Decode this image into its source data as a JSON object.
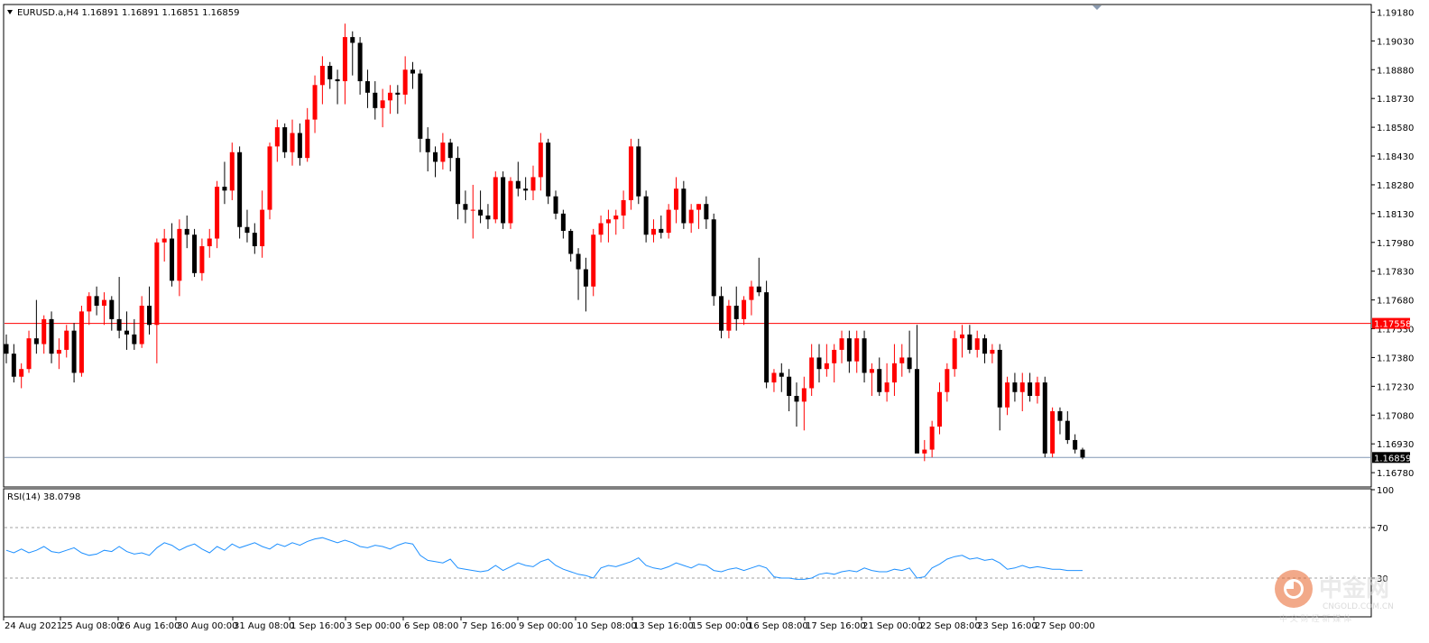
{
  "window": {
    "header": "EURUSD.a,H4  1.16891 1.16891 1.16851 1.16859",
    "rsi_header": "RSI(14) 38.0798"
  },
  "chart_data": [
    {
      "type": "candlestick",
      "title": "EURUSD.a,H4",
      "ohlc_last": {
        "open": 1.16891,
        "high": 1.16891,
        "low": 1.16851,
        "close": 1.16859
      },
      "ylim": [
        1.1671,
        1.19215
      ],
      "y_ticks": [
        "1.19180",
        "1.19030",
        "1.18880",
        "1.18730",
        "1.18580",
        "1.18430",
        "1.18280",
        "1.18130",
        "1.17980",
        "1.17830",
        "1.17680",
        "1.17530",
        "1.17380",
        "1.17230",
        "1.17080",
        "1.16930",
        "1.16780"
      ],
      "x_ticks": [
        "24 Aug 2021",
        "25 Aug 08:00",
        "26 Aug 16:00",
        "30 Aug 00:00",
        "31 Aug 08:00",
        "1 Sep 16:00",
        "3 Sep 00:00",
        "6 Sep 08:00",
        "7 Sep 16:00",
        "9 Sep 00:00",
        "10 Sep 08:00",
        "13 Sep 16:00",
        "15 Sep 00:00",
        "16 Sep 08:00",
        "17 Sep 16:00",
        "21 Sep 00:00",
        "22 Sep 08:00",
        "23 Sep 16:00",
        "27 Sep 00:00"
      ],
      "h_lines": [
        {
          "value": 1.17558,
          "label": "1.17558",
          "color": "#ff0000"
        },
        {
          "value": 1.16859,
          "label": "1.16859",
          "color": "#8096b4"
        }
      ],
      "candles": [
        [
          1.1745,
          1.175,
          1.1735,
          1.174
        ],
        [
          1.174,
          1.1745,
          1.1725,
          1.1728
        ],
        [
          1.1728,
          1.1735,
          1.1722,
          1.1732
        ],
        [
          1.1732,
          1.1752,
          1.173,
          1.1748
        ],
        [
          1.1748,
          1.1768,
          1.174,
          1.1745
        ],
        [
          1.1745,
          1.176,
          1.174,
          1.1758
        ],
        [
          1.1758,
          1.1762,
          1.1735,
          1.174
        ],
        [
          1.174,
          1.1748,
          1.1732,
          1.1742
        ],
        [
          1.1742,
          1.1755,
          1.1738,
          1.1752
        ],
        [
          1.1752,
          1.1756,
          1.1725,
          1.173
        ],
        [
          1.173,
          1.1765,
          1.1728,
          1.1762
        ],
        [
          1.1762,
          1.1772,
          1.1755,
          1.177
        ],
        [
          1.177,
          1.1775,
          1.176,
          1.1765
        ],
        [
          1.1765,
          1.1772,
          1.1755,
          1.1768
        ],
        [
          1.1768,
          1.177,
          1.1752,
          1.1758
        ],
        [
          1.1758,
          1.178,
          1.1748,
          1.1752
        ],
        [
          1.1752,
          1.1762,
          1.1742,
          1.175
        ],
        [
          1.175,
          1.1758,
          1.1742,
          1.1745
        ],
        [
          1.1745,
          1.177,
          1.1743,
          1.1765
        ],
        [
          1.1765,
          1.1775,
          1.175,
          1.1755
        ],
        [
          1.1755,
          1.18,
          1.1735,
          1.1798
        ],
        [
          1.1798,
          1.1805,
          1.1788,
          1.18
        ],
        [
          1.18,
          1.1808,
          1.1775,
          1.1778
        ],
        [
          1.1778,
          1.181,
          1.177,
          1.1805
        ],
        [
          1.1805,
          1.1812,
          1.1795,
          1.1802
        ],
        [
          1.1802,
          1.1805,
          1.178,
          1.1782
        ],
        [
          1.1782,
          1.18,
          1.1778,
          1.1796
        ],
        [
          1.1796,
          1.1805,
          1.179,
          1.18
        ],
        [
          1.18,
          1.183,
          1.1795,
          1.1827
        ],
        [
          1.1827,
          1.184,
          1.1818,
          1.1825
        ],
        [
          1.1825,
          1.185,
          1.182,
          1.1845
        ],
        [
          1.1845,
          1.1848,
          1.18,
          1.1806
        ],
        [
          1.1806,
          1.1815,
          1.1798,
          1.1803
        ],
        [
          1.1803,
          1.1808,
          1.1792,
          1.1796
        ],
        [
          1.1796,
          1.1825,
          1.179,
          1.1815
        ],
        [
          1.1815,
          1.185,
          1.181,
          1.1848
        ],
        [
          1.1848,
          1.1862,
          1.184,
          1.1858
        ],
        [
          1.1858,
          1.186,
          1.1842,
          1.1845
        ],
        [
          1.1845,
          1.1862,
          1.1838,
          1.1855
        ],
        [
          1.1855,
          1.186,
          1.1838,
          1.1842
        ],
        [
          1.1842,
          1.1868,
          1.184,
          1.1862
        ],
        [
          1.1862,
          1.1885,
          1.1855,
          1.188
        ],
        [
          1.188,
          1.1895,
          1.187,
          1.189
        ],
        [
          1.189,
          1.1892,
          1.1878,
          1.1883
        ],
        [
          1.1883,
          1.1888,
          1.187,
          1.1882
        ],
        [
          1.1882,
          1.1912,
          1.187,
          1.1905
        ],
        [
          1.1905,
          1.1908,
          1.1885,
          1.1902
        ],
        [
          1.1902,
          1.1905,
          1.1875,
          1.1882
        ],
        [
          1.1882,
          1.1888,
          1.1868,
          1.1876
        ],
        [
          1.1876,
          1.1882,
          1.1862,
          1.1868
        ],
        [
          1.1868,
          1.1878,
          1.1858,
          1.1872
        ],
        [
          1.1872,
          1.188,
          1.1865,
          1.1876
        ],
        [
          1.1876,
          1.188,
          1.1865,
          1.1875
        ],
        [
          1.1875,
          1.1895,
          1.187,
          1.1888
        ],
        [
          1.1888,
          1.1892,
          1.1878,
          1.1886
        ],
        [
          1.1886,
          1.1888,
          1.1845,
          1.1852
        ],
        [
          1.1852,
          1.1858,
          1.1835,
          1.1845
        ],
        [
          1.1845,
          1.1848,
          1.1832,
          1.184
        ],
        [
          1.184,
          1.1855,
          1.1836,
          1.185
        ],
        [
          1.185,
          1.1852,
          1.1835,
          1.1842
        ],
        [
          1.1842,
          1.1848,
          1.181,
          1.1818
        ],
        [
          1.1818,
          1.1825,
          1.1808,
          1.1815
        ],
        [
          1.1815,
          1.1828,
          1.18,
          1.1815
        ],
        [
          1.1815,
          1.1825,
          1.1808,
          1.1812
        ],
        [
          1.1812,
          1.1818,
          1.1805,
          1.181
        ],
        [
          1.181,
          1.1835,
          1.1808,
          1.1832
        ],
        [
          1.1832,
          1.1835,
          1.1805,
          1.1808
        ],
        [
          1.1808,
          1.1832,
          1.1805,
          1.183
        ],
        [
          1.183,
          1.184,
          1.1822,
          1.1826
        ],
        [
          1.1826,
          1.1832,
          1.182,
          1.1825
        ],
        [
          1.1825,
          1.1838,
          1.182,
          1.1832
        ],
        [
          1.1832,
          1.1855,
          1.1825,
          1.185
        ],
        [
          1.185,
          1.1852,
          1.1818,
          1.1822
        ],
        [
          1.1822,
          1.1825,
          1.181,
          1.1813
        ],
        [
          1.1813,
          1.1815,
          1.18,
          1.1804
        ],
        [
          1.1804,
          1.1805,
          1.1788,
          1.1792
        ],
        [
          1.1792,
          1.1795,
          1.1768,
          1.1784
        ],
        [
          1.1784,
          1.179,
          1.1762,
          1.1775
        ],
        [
          1.1775,
          1.1805,
          1.177,
          1.1802
        ],
        [
          1.1802,
          1.1812,
          1.1798,
          1.1808
        ],
        [
          1.1808,
          1.1815,
          1.1798,
          1.181
        ],
        [
          1.181,
          1.1815,
          1.1802,
          1.1812
        ],
        [
          1.1812,
          1.1825,
          1.1805,
          1.182
        ],
        [
          1.182,
          1.1852,
          1.1815,
          1.1848
        ],
        [
          1.1848,
          1.1852,
          1.1818,
          1.1822
        ],
        [
          1.1822,
          1.1825,
          1.1798,
          1.1802
        ],
        [
          1.1802,
          1.181,
          1.1798,
          1.1805
        ],
        [
          1.1805,
          1.1812,
          1.18,
          1.1803
        ],
        [
          1.1803,
          1.1818,
          1.18,
          1.1815
        ],
        [
          1.1815,
          1.1832,
          1.1808,
          1.1826
        ],
        [
          1.1826,
          1.183,
          1.1805,
          1.1808
        ],
        [
          1.1808,
          1.1818,
          1.1803,
          1.1815
        ],
        [
          1.1815,
          1.1818,
          1.1805,
          1.1818
        ],
        [
          1.1818,
          1.1822,
          1.1805,
          1.181
        ],
        [
          1.181,
          1.1813,
          1.1765,
          1.177
        ],
        [
          1.177,
          1.1775,
          1.1748,
          1.1752
        ],
        [
          1.1752,
          1.1768,
          1.1748,
          1.1765
        ],
        [
          1.1765,
          1.1775,
          1.1752,
          1.1758
        ],
        [
          1.1758,
          1.177,
          1.1755,
          1.1768
        ],
        [
          1.1768,
          1.1778,
          1.176,
          1.1775
        ],
        [
          1.1775,
          1.179,
          1.177,
          1.1772
        ],
        [
          1.1772,
          1.1778,
          1.1722,
          1.1725
        ],
        [
          1.1725,
          1.1732,
          1.172,
          1.173
        ],
        [
          1.173,
          1.1735,
          1.172,
          1.1728
        ],
        [
          1.1728,
          1.1732,
          1.171,
          1.1718
        ],
        [
          1.1718,
          1.1725,
          1.1702,
          1.1715
        ],
        [
          1.1715,
          1.1728,
          1.17,
          1.1722
        ],
        [
          1.1722,
          1.1745,
          1.1718,
          1.1738
        ],
        [
          1.1738,
          1.1745,
          1.1725,
          1.1732
        ],
        [
          1.1732,
          1.1745,
          1.1728,
          1.1735
        ],
        [
          1.1735,
          1.1745,
          1.1725,
          1.1742
        ],
        [
          1.1742,
          1.1752,
          1.1735,
          1.1748
        ],
        [
          1.1748,
          1.1752,
          1.173,
          1.1736
        ],
        [
          1.1736,
          1.1752,
          1.173,
          1.1748
        ],
        [
          1.1748,
          1.1752,
          1.1725,
          1.173
        ],
        [
          1.173,
          1.1735,
          1.1718,
          1.1732
        ],
        [
          1.1732,
          1.1738,
          1.1718,
          1.172
        ],
        [
          1.172,
          1.1735,
          1.1715,
          1.1725
        ],
        [
          1.1725,
          1.1745,
          1.1718,
          1.1735
        ],
        [
          1.1735,
          1.1745,
          1.1728,
          1.1738
        ],
        [
          1.1738,
          1.1752,
          1.173,
          1.1732
        ],
        [
          1.1732,
          1.1755,
          1.169,
          1.1688
        ],
        [
          1.1688,
          1.1695,
          1.1684,
          1.169
        ],
        [
          1.169,
          1.1705,
          1.1686,
          1.1702
        ],
        [
          1.1702,
          1.1725,
          1.1698,
          1.172
        ],
        [
          1.172,
          1.1735,
          1.1715,
          1.1732
        ],
        [
          1.1732,
          1.1752,
          1.1728,
          1.1748
        ],
        [
          1.1748,
          1.1755,
          1.1738,
          1.175
        ],
        [
          1.175,
          1.1755,
          1.174,
          1.1742
        ],
        [
          1.1742,
          1.1752,
          1.1738,
          1.1748
        ],
        [
          1.1748,
          1.175,
          1.1735,
          1.174
        ],
        [
          1.174,
          1.1745,
          1.1735,
          1.1742
        ],
        [
          1.1742,
          1.1745,
          1.17,
          1.1712
        ],
        [
          1.1712,
          1.1728,
          1.1708,
          1.1725
        ],
        [
          1.1725,
          1.173,
          1.1715,
          1.172
        ],
        [
          1.172,
          1.173,
          1.171,
          1.1725
        ],
        [
          1.1725,
          1.173,
          1.1715,
          1.1718
        ],
        [
          1.1718,
          1.1728,
          1.1714,
          1.1725
        ],
        [
          1.1725,
          1.1728,
          1.1686,
          1.1688
        ],
        [
          1.1688,
          1.1712,
          1.1686,
          1.171
        ],
        [
          1.171,
          1.1712,
          1.1698,
          1.1705
        ],
        [
          1.1705,
          1.171,
          1.1693,
          1.1695
        ],
        [
          1.1695,
          1.1698,
          1.1688,
          1.169
        ],
        [
          1.169,
          1.1691,
          1.1685,
          1.16859
        ]
      ],
      "rsi": {
        "name": "RSI(14)",
        "value": 38.0798,
        "ylim": [
          0,
          100
        ],
        "y_ticks": [
          "100",
          "70",
          "30"
        ],
        "levels": [
          70,
          30
        ],
        "color": "#1e90ff",
        "values": [
          52,
          50,
          53,
          50,
          52,
          55,
          51,
          50,
          52,
          54,
          50,
          48,
          49,
          52,
          51,
          55,
          51,
          49,
          50,
          48,
          54,
          58,
          56,
          52,
          55,
          57,
          53,
          50,
          55,
          52,
          57,
          54,
          56,
          58,
          55,
          53,
          57,
          55,
          58,
          56,
          59,
          61,
          62,
          60,
          58,
          60,
          58,
          55,
          54,
          56,
          55,
          53,
          56,
          58,
          57,
          48,
          44,
          43,
          42,
          45,
          38,
          37,
          36,
          35,
          36,
          40,
          36,
          39,
          42,
          40,
          39,
          43,
          45,
          40,
          37,
          35,
          33,
          32,
          30,
          38,
          40,
          39,
          41,
          43,
          46,
          40,
          38,
          37,
          39,
          42,
          40,
          38,
          41,
          40,
          36,
          35,
          37,
          38,
          36,
          38,
          40,
          38,
          31,
          30,
          30,
          29,
          29,
          30,
          33,
          34,
          33,
          35,
          36,
          35,
          38,
          36,
          35,
          35,
          37,
          36,
          38,
          30,
          31,
          38,
          41,
          45,
          47,
          48,
          45,
          46,
          44,
          45,
          42,
          37,
          38,
          40,
          38,
          39,
          38,
          37,
          37,
          36,
          36,
          36
        ]
      }
    }
  ],
  "watermark": {
    "brand": "中金网",
    "domain": "CNGOLD.COM.CN",
    "tagline": "中 文 财 经 新 媒 体"
  }
}
